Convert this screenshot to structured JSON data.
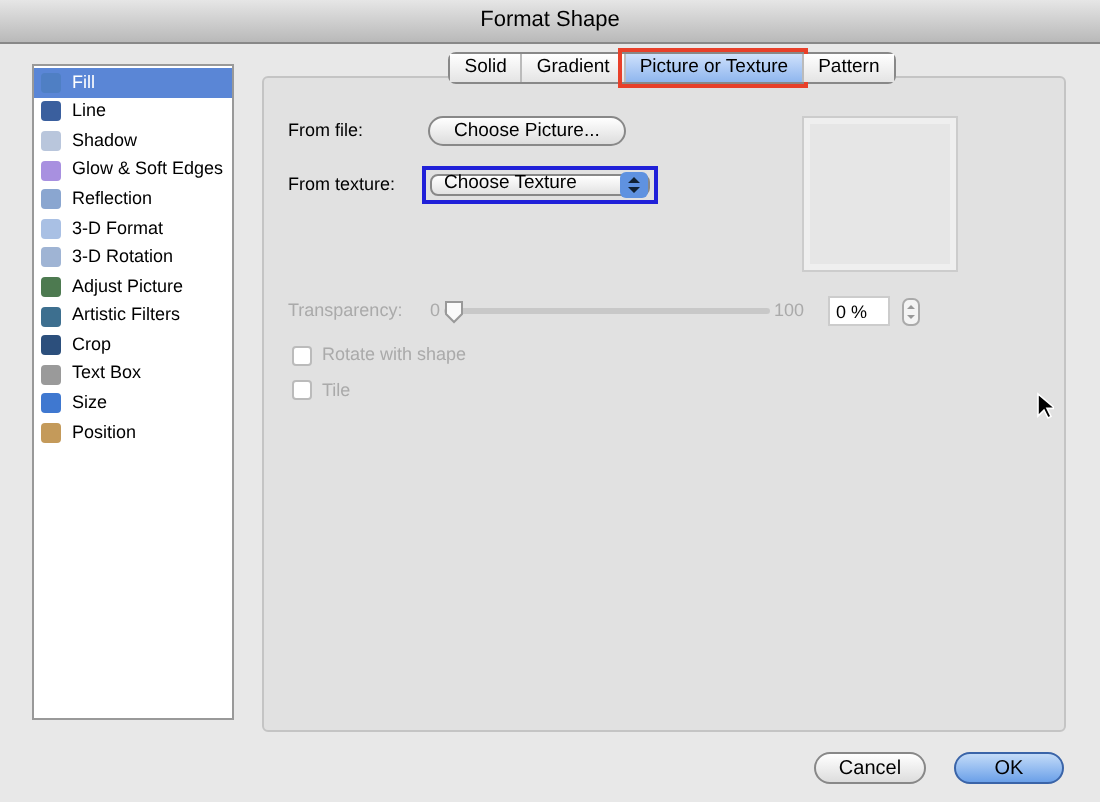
{
  "window": {
    "title": "Format Shape"
  },
  "sidebar": {
    "items": [
      {
        "label": "Fill",
        "selected": true,
        "color": "#4f7fc4"
      },
      {
        "label": "Line",
        "selected": false,
        "color": "#3a5f9e"
      },
      {
        "label": "Shadow",
        "selected": false,
        "color": "#b9c6dc"
      },
      {
        "label": "Glow & Soft Edges",
        "selected": false,
        "color": "#a890e0"
      },
      {
        "label": "Reflection",
        "selected": false,
        "color": "#8aa6d0"
      },
      {
        "label": "3-D Format",
        "selected": false,
        "color": "#a9c0e4"
      },
      {
        "label": "3-D Rotation",
        "selected": false,
        "color": "#9fb4d4"
      },
      {
        "label": "Adjust Picture",
        "selected": false,
        "color": "#4d7a50"
      },
      {
        "label": "Artistic Filters",
        "selected": false,
        "color": "#3d6f8f"
      },
      {
        "label": "Crop",
        "selected": false,
        "color": "#2c4f7c"
      },
      {
        "label": "Text Box",
        "selected": false,
        "color": "#9a9a9a"
      },
      {
        "label": "Size",
        "selected": false,
        "color": "#3f78d0"
      },
      {
        "label": "Position",
        "selected": false,
        "color": "#c49a5a"
      }
    ]
  },
  "tabs": [
    {
      "label": "Solid",
      "selected": false
    },
    {
      "label": "Gradient",
      "selected": false
    },
    {
      "label": "Picture or Texture",
      "selected": true
    },
    {
      "label": "Pattern",
      "selected": false
    }
  ],
  "from_file": {
    "label": "From file:",
    "button": "Choose Picture..."
  },
  "from_texture": {
    "label": "From texture:",
    "value": "Choose Texture",
    "highlighted": true
  },
  "transparency": {
    "label": "Transparency:",
    "min": "0",
    "max": "100",
    "level": 0,
    "value": "0 %",
    "disabled": true
  },
  "options": [
    {
      "label": "Rotate with shape",
      "checked": false,
      "disabled": true
    },
    {
      "label": "Tile",
      "checked": false,
      "disabled": true
    }
  ],
  "buttons": [
    {
      "label": "Cancel",
      "kind": "secondary"
    },
    {
      "label": "OK",
      "kind": "primary"
    }
  ]
}
